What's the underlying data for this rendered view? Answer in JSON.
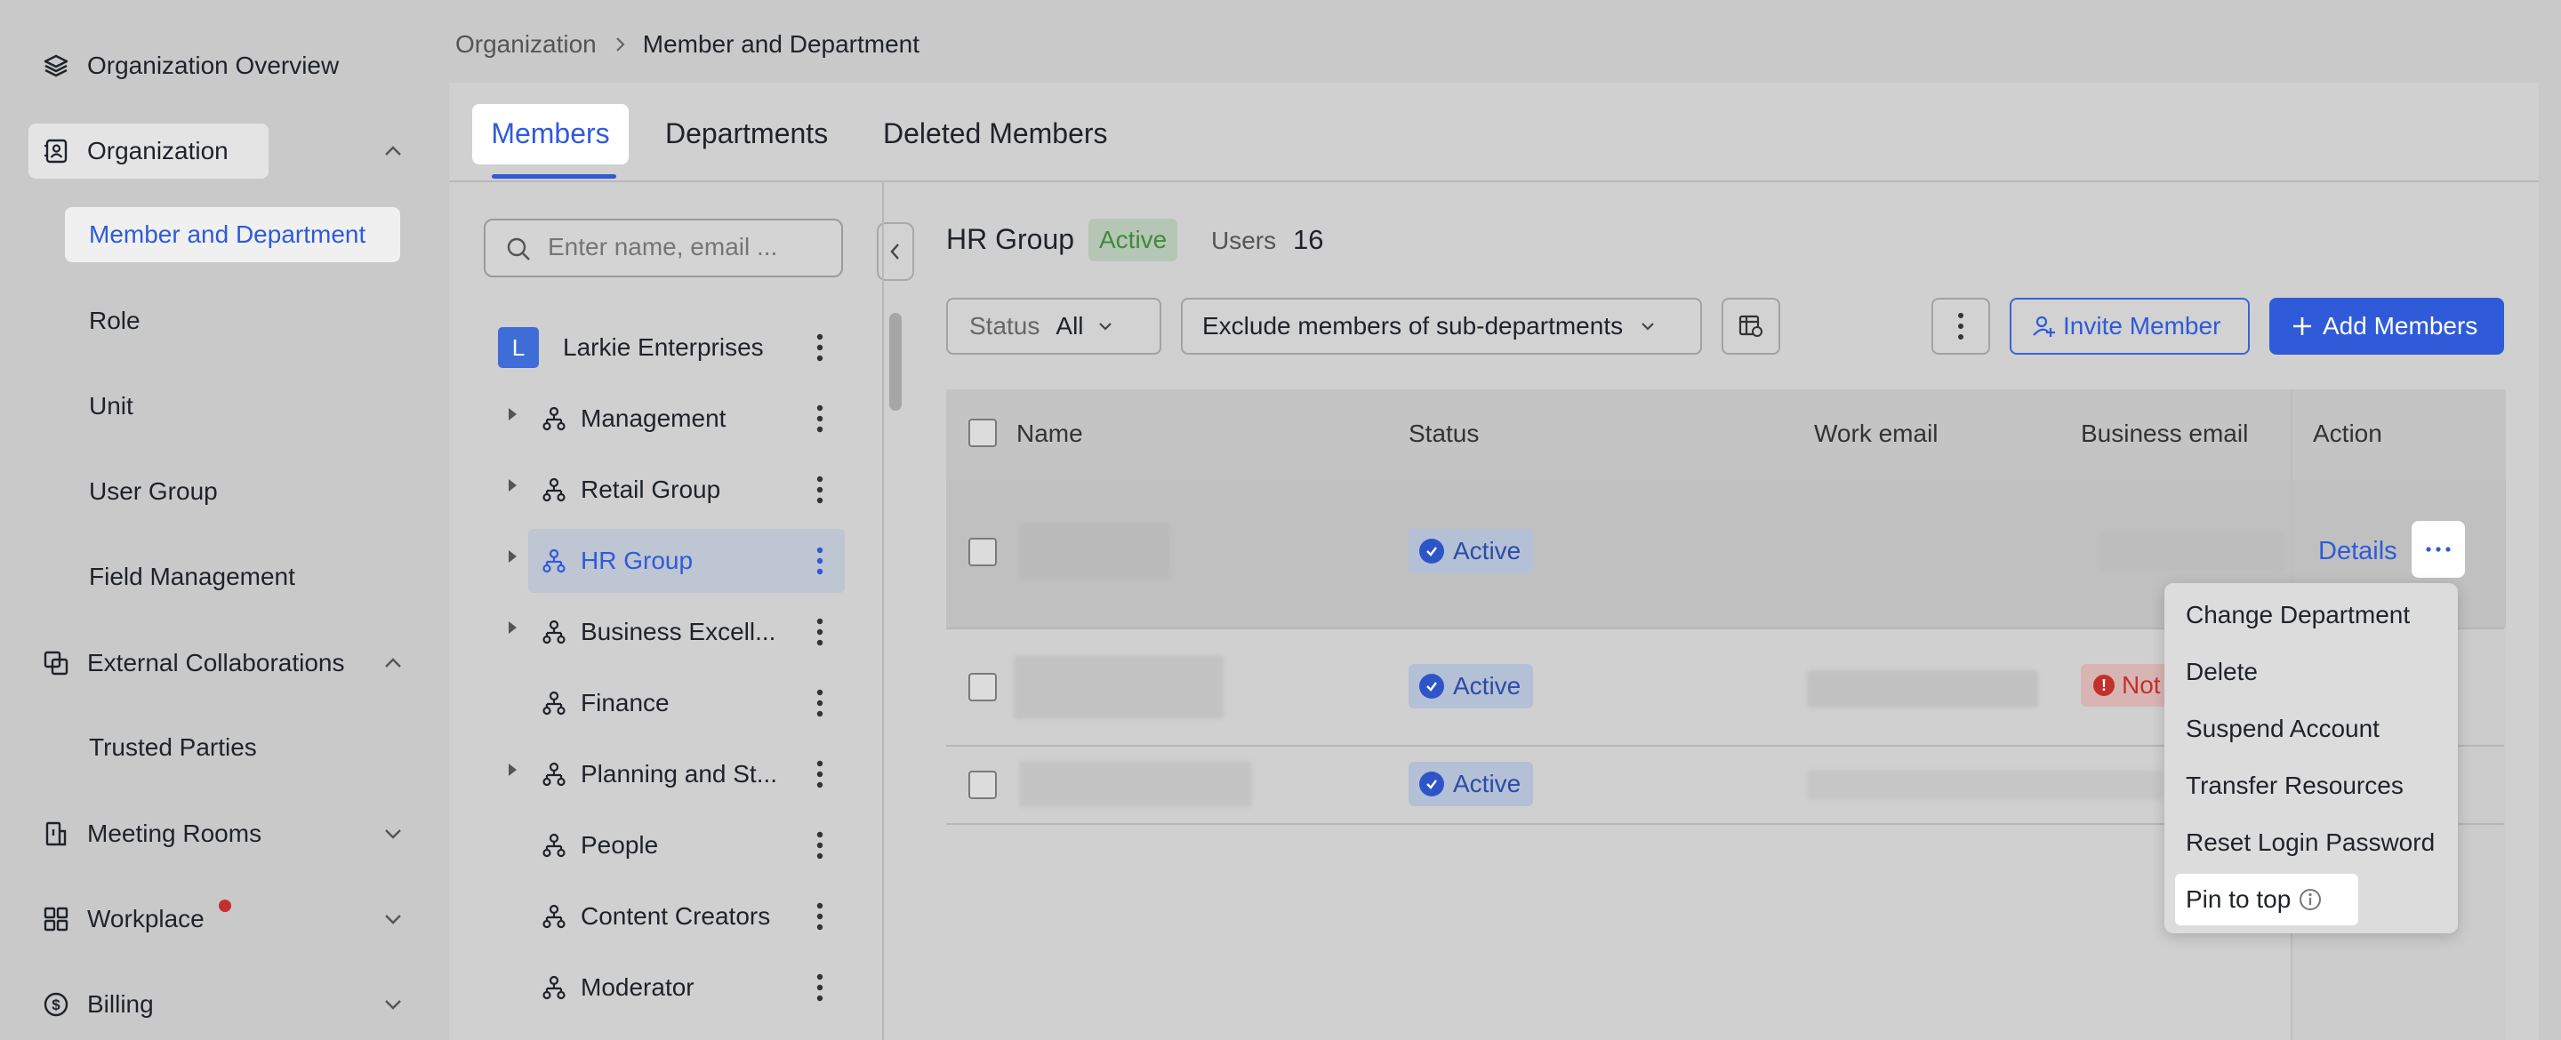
{
  "sidebar": {
    "overview": "Organization Overview",
    "organization": "Organization",
    "org_children": [
      "Member and Department",
      "Role",
      "Unit",
      "User Group",
      "Field Management"
    ],
    "external": "External Collaborations",
    "trusted": "Trusted Parties",
    "meeting_rooms": "Meeting Rooms",
    "workplace": "Workplace",
    "billing": "Billing"
  },
  "breadcrumb": {
    "parent": "Organization",
    "current": "Member and Department"
  },
  "tabs": [
    "Members",
    "Departments",
    "Deleted Members"
  ],
  "search": {
    "placeholder": "Enter name, email ..."
  },
  "tree": {
    "root_initial": "L",
    "root_name": "Larkie Enterprises",
    "items": [
      "Management",
      "Retail Group",
      "HR Group",
      "Business Excell...",
      "Finance",
      "Planning and St...",
      "People",
      "Content Creators",
      "Moderator"
    ]
  },
  "group": {
    "name": "HR Group",
    "status": "Active",
    "users_label": "Users",
    "users_count": "16"
  },
  "toolbar": {
    "status_label": "Status",
    "status_value": "All",
    "filter": "Exclude members of sub-departments",
    "invite": "Invite Member",
    "add": "Add Members"
  },
  "table": {
    "headers": [
      "Name",
      "Status",
      "Work email",
      "Business email",
      "Action"
    ],
    "rows": [
      {
        "status": "Active",
        "details": "Details"
      },
      {
        "status": "Active",
        "business_badge": "Not"
      },
      {
        "status": "Active"
      }
    ]
  },
  "context_menu": [
    "Change Department",
    "Delete",
    "Suspend Account",
    "Transfer Resources",
    "Reset Login Password",
    "Pin to top"
  ],
  "colors": {
    "accent": "#2f5bd8",
    "active_green": "#3e8a3b",
    "danger": "#c4302b"
  }
}
